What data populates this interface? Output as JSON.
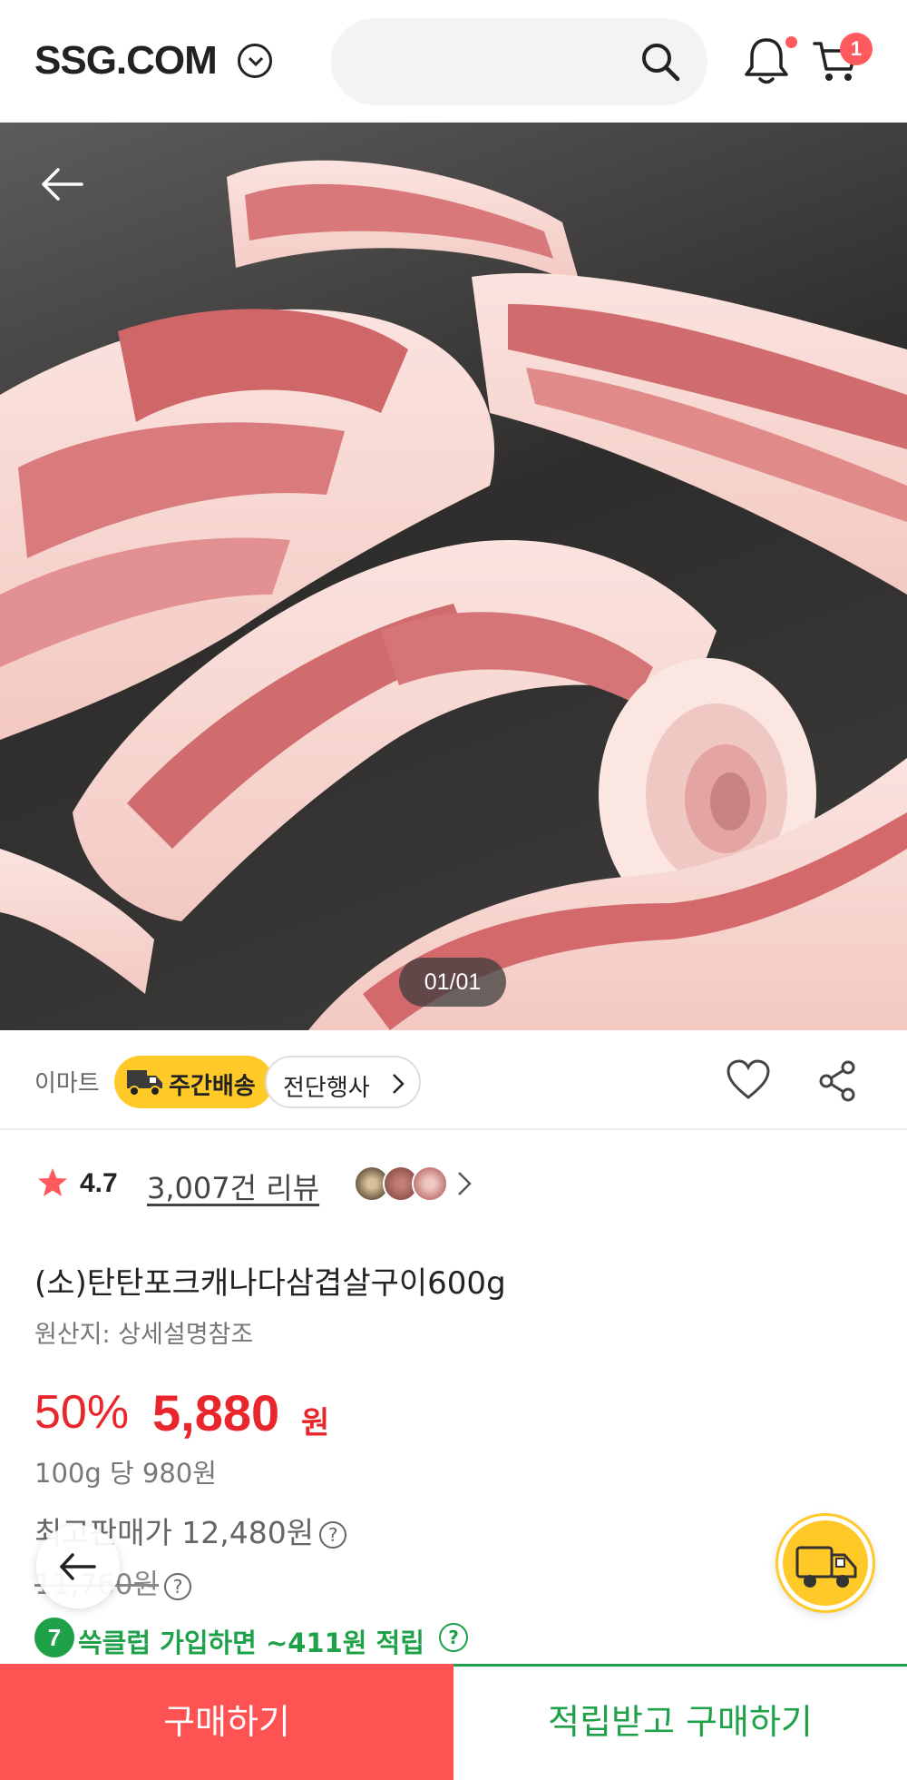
{
  "header": {
    "logo": "SSG.COM",
    "cart_count": "1"
  },
  "hero": {
    "pager": "01/01"
  },
  "tags": {
    "store": "이마트",
    "weekly_delivery": "주간배송",
    "event": "전단행사"
  },
  "review": {
    "rating": "4.7",
    "review_count": "3,007건 리뷰"
  },
  "product": {
    "title": "(소)탄탄포크캐나다삼겹살구이600g",
    "origin": "원산지: 상세설명참조",
    "discount": "50%",
    "price": "5,880",
    "price_unit": "원",
    "per_100g": "100g 당 980원",
    "max_price": "최고판매가 12,480원",
    "original_price": "11,760원"
  },
  "club": {
    "icon_label": "7",
    "text": "쓱클럽 가입하면 ~411원 적립"
  },
  "bottom": {
    "buy_label": "구매하기",
    "earn_label": "적립받고 구매하기"
  },
  "colors": {
    "accent_red": "#e8262b",
    "buy_button": "#ff5252",
    "club_green": "#1fa14a",
    "badge_yellow": "#ffc928"
  }
}
